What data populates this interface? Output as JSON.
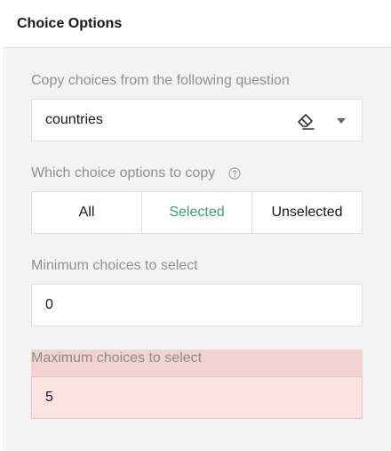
{
  "panel": {
    "title": "Choice Options"
  },
  "copy_choices": {
    "label": "Copy choices from the following question",
    "value": "countries",
    "icons": {
      "clear": "eraser-icon",
      "dropdown": "chevron-down-icon"
    }
  },
  "choice_options": {
    "label": "Which choice options to copy",
    "help_icon": "question-circle-icon",
    "segments": [
      "All",
      "Selected",
      "Unselected"
    ],
    "selected": "Selected",
    "selected_color": "#3f9b7d"
  },
  "min_choices": {
    "label": "Minimum choices to select",
    "value": "0"
  },
  "max_choices": {
    "label": "Maximum choices to select",
    "value": "5",
    "error_color": "#fde2e2"
  }
}
